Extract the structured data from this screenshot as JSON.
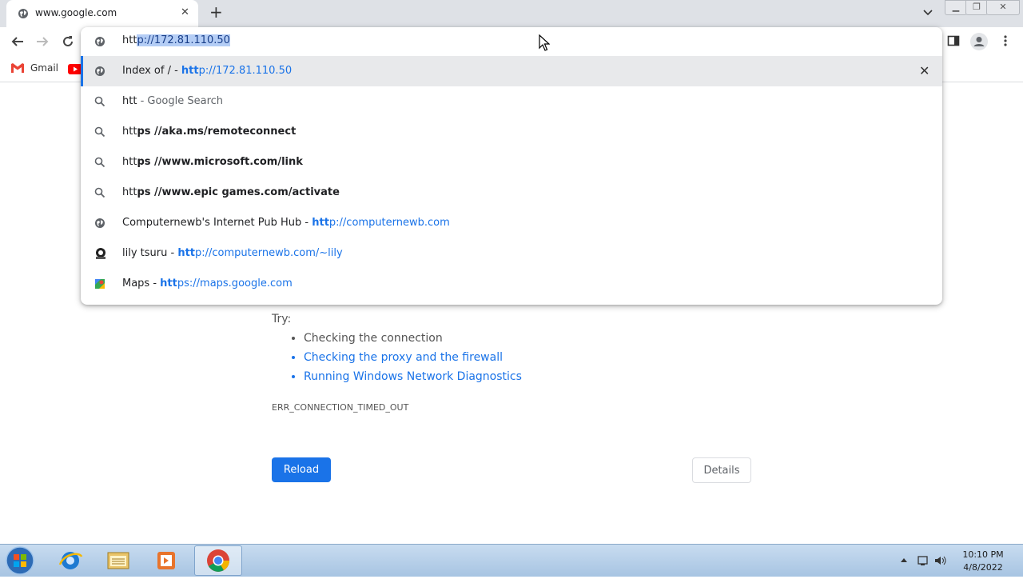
{
  "tab": {
    "title": "www.google.com"
  },
  "bookmarks": {
    "gmail": "Gmail"
  },
  "omnibox": {
    "typed": "htt",
    "autocomplete": "p://172.81.110.50",
    "suggestions": [
      {
        "pre": "Index of / - ",
        "b": "htt",
        "post": "p://172.81.110.50",
        "type": "history"
      },
      {
        "pre": "htt",
        "b": "",
        "post": " - Google Search",
        "type": "search"
      },
      {
        "pre": "htt",
        "b": "ps //aka.ms/remoteconnect",
        "post": "",
        "type": "search"
      },
      {
        "pre": "htt",
        "b": "ps //www.microsoft.com/link",
        "post": "",
        "type": "search"
      },
      {
        "pre": "htt",
        "b": "ps //www.epic games.com/activate",
        "post": "",
        "type": "search"
      },
      {
        "pre": "Computernewb's Internet Pub Hub - ",
        "b": "htt",
        "post": "p://computernewb.com",
        "type": "history"
      },
      {
        "pre": "lily tsuru - ",
        "b": "htt",
        "post": "p://computernewb.com/~lily",
        "type": "site"
      },
      {
        "pre": "Maps - ",
        "b": "htt",
        "post": "ps://maps.google.com",
        "type": "maps"
      }
    ]
  },
  "error_page": {
    "try_label": "Try:",
    "suggestions": [
      "Checking the connection",
      "Checking the proxy and the firewall",
      "Running Windows Network Diagnostics"
    ],
    "error_code": "ERR_CONNECTION_TIMED_OUT",
    "reload_label": "Reload",
    "details_label": "Details"
  },
  "taskbar": {
    "time": "10:10 PM",
    "date": "4/8/2022"
  },
  "colors": {
    "accent": "#1a73e8",
    "link": "#1a73e8",
    "tabstrip": "#dee1e6"
  }
}
